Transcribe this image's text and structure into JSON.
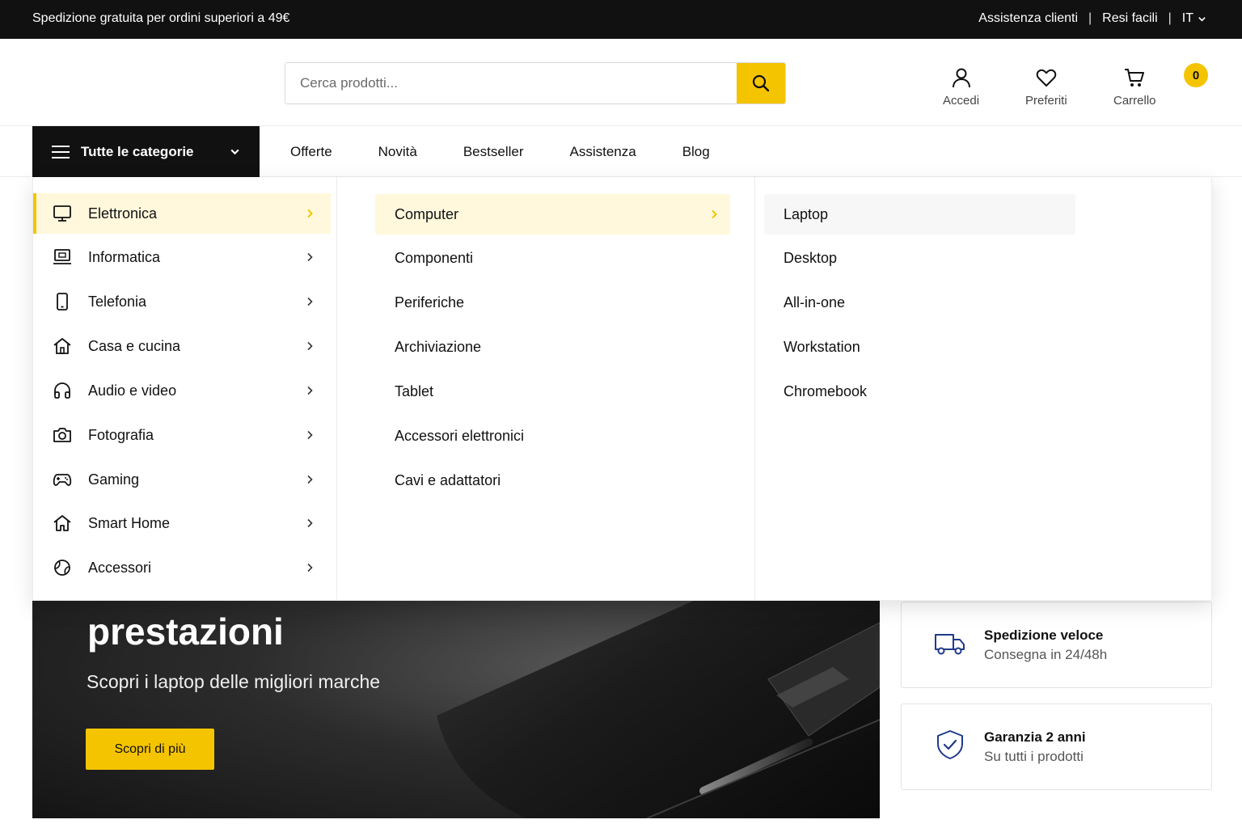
{
  "topbar": {
    "promo": "Spedizione gratuita per ordini superiori a 49€",
    "support": "Assistenza clienti",
    "returns": "Resi facili",
    "lang": "IT"
  },
  "header": {
    "search_placeholder": "Cerca prodotti...",
    "login": "Accedi",
    "favorites": "Preferiti",
    "cart": "Carrello",
    "cart_count": "0"
  },
  "nav": {
    "all_categories": "Tutte le categorie",
    "links": [
      "Offerte",
      "Novità",
      "Bestseller",
      "Assistenza",
      "Blog"
    ]
  },
  "mega_menu": {
    "categories": [
      {
        "label": "Elettronica",
        "icon": "monitor-icon",
        "active": true
      },
      {
        "label": "Informatica",
        "icon": "laptop-icon"
      },
      {
        "label": "Telefonia",
        "icon": "smartphone-icon"
      },
      {
        "label": "Casa e cucina",
        "icon": "house-icon"
      },
      {
        "label": "Audio e video",
        "icon": "headphones-icon"
      },
      {
        "label": "Fotografia",
        "icon": "camera-icon"
      },
      {
        "label": "Gaming",
        "icon": "gamepad-icon"
      },
      {
        "label": "Smart Home",
        "icon": "smart-home-icon"
      },
      {
        "label": "Accessori",
        "icon": "accessories-icon"
      }
    ],
    "subcategories": [
      {
        "label": "Computer",
        "active": true
      },
      {
        "label": "Componenti"
      },
      {
        "label": "Periferiche"
      },
      {
        "label": "Archiviazione"
      },
      {
        "label": "Tablet"
      },
      {
        "label": "Accessori elettronici"
      },
      {
        "label": "Cavi e adattatori"
      }
    ],
    "leaves": [
      {
        "label": "Laptop",
        "active": true
      },
      {
        "label": "Desktop"
      },
      {
        "label": "All-in-one"
      },
      {
        "label": "Workstation"
      },
      {
        "label": "Chromebook"
      }
    ]
  },
  "hero": {
    "title": "prestazioni",
    "subtitle": "Scopri i laptop delle migliori marche",
    "cta": "Scopri di più"
  },
  "features": [
    {
      "title": "Spedizione veloce",
      "subtitle": "Consegna in 24/48h",
      "icon": "truck-icon"
    },
    {
      "title": "Garanzia 2 anni",
      "subtitle": "Su tutti i prodotti",
      "icon": "shield-check-icon"
    }
  ],
  "colors": {
    "accent": "#f5c400",
    "dark": "#111111",
    "highlight": "#fff8dc",
    "icon_blue": "#1f3a8a"
  }
}
